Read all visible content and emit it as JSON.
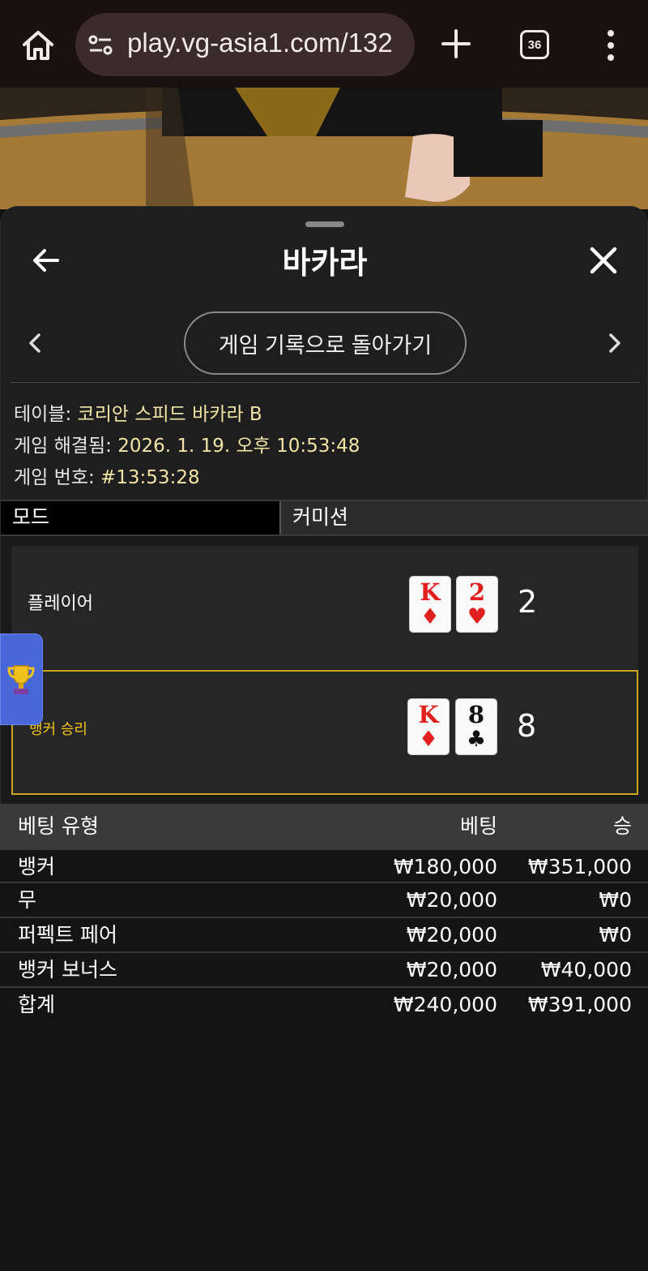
{
  "browser": {
    "url": "play.vg-asia1.com/132",
    "tab_count": "36"
  },
  "sheet": {
    "title": "바카라",
    "history_button": "게임 기록으로 돌아가기"
  },
  "info": {
    "table_label": "테이블:",
    "table_value": "코리안 스피드 바카라 B",
    "resolved_label": "게임 해결됨:",
    "resolved_value": "2026. 1. 19. 오후 10:53:48",
    "number_label": "게임 번호:",
    "number_value": "#13:53:28"
  },
  "mode": {
    "label": "모드",
    "value": "커미션"
  },
  "hands": {
    "player": {
      "label": "플레이어",
      "cards": [
        {
          "rank": "K",
          "suit": "♦",
          "color": "red"
        },
        {
          "rank": "2",
          "suit": "♥",
          "color": "red"
        }
      ],
      "total": "2"
    },
    "banker": {
      "label": "뱅커 승리",
      "cards": [
        {
          "rank": "K",
          "suit": "♦",
          "color": "red"
        },
        {
          "rank": "8",
          "suit": "♣",
          "color": "black"
        }
      ],
      "total": "8"
    }
  },
  "bets": {
    "headers": {
      "type": "베팅 유형",
      "bet": "베팅",
      "win": "승"
    },
    "rows": [
      {
        "type": "뱅커",
        "bet": "₩180,000",
        "win": "₩351,000"
      },
      {
        "type": "무",
        "bet": "₩20,000",
        "win": "₩0"
      },
      {
        "type": "퍼펙트 페어",
        "bet": "₩20,000",
        "win": "₩0"
      },
      {
        "type": "뱅커 보너스",
        "bet": "₩20,000",
        "win": "₩40,000"
      }
    ],
    "total": {
      "type": "합계",
      "bet": "₩240,000",
      "win": "₩391,000"
    }
  },
  "colors": {
    "accent_gold": "#c9a81c",
    "banker_win_text": "#f5c518",
    "info_value": "#f1e4a6",
    "trophy_tab": "#4867d8"
  },
  "icons": [
    "home-icon",
    "site-info-icon",
    "plus-icon",
    "tabs-icon",
    "more-vert-icon",
    "back-arrow-icon",
    "close-icon",
    "chevron-left-icon",
    "chevron-right-icon",
    "trophy-icon"
  ]
}
